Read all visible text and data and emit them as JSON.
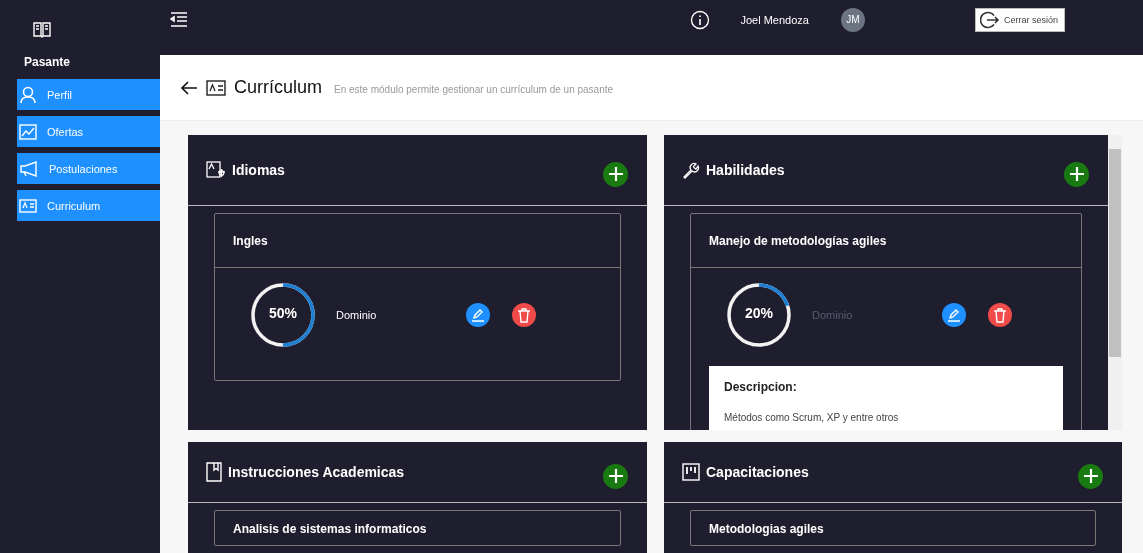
{
  "sidebar": {
    "section_title": "Pasante",
    "items": [
      {
        "label": "Perfil"
      },
      {
        "label": "Ofertas"
      },
      {
        "label": "Postulaciones"
      },
      {
        "label": "Curriculum"
      }
    ]
  },
  "topbar": {
    "user_name": "Joel Mendoza",
    "avatar_initials": "JM",
    "logout_button": "Cerrar sesión"
  },
  "page": {
    "title": "Currículum",
    "subtitle": "En este módulo permite gestionar un currículum de un pasante"
  },
  "cards": [
    {
      "title": "Idiomas",
      "scrollable": false,
      "items": [
        {
          "name": "Ingles",
          "level": 0.5,
          "reading": "50%",
          "label": "Dominio",
          "dimmed": false
        }
      ]
    },
    {
      "title": "Habilidades",
      "scrollable": true,
      "items": [
        {
          "name": "Manejo de metodologías agiles",
          "level": 0.2,
          "reading": "20%",
          "label": "Dominio",
          "dimmed": true,
          "description_title": "Descripcion:",
          "description": "Métodos como Scrum, XP y entre otros"
        }
      ]
    },
    {
      "title": "Instrucciones Academicas",
      "scrollable": false,
      "items": [
        {
          "name": "Analisis de sistemas informaticos"
        }
      ]
    },
    {
      "title": "Capacitaciones",
      "scrollable": false,
      "items": [
        {
          "name": "Metodologias agiles"
        }
      ]
    }
  ]
}
